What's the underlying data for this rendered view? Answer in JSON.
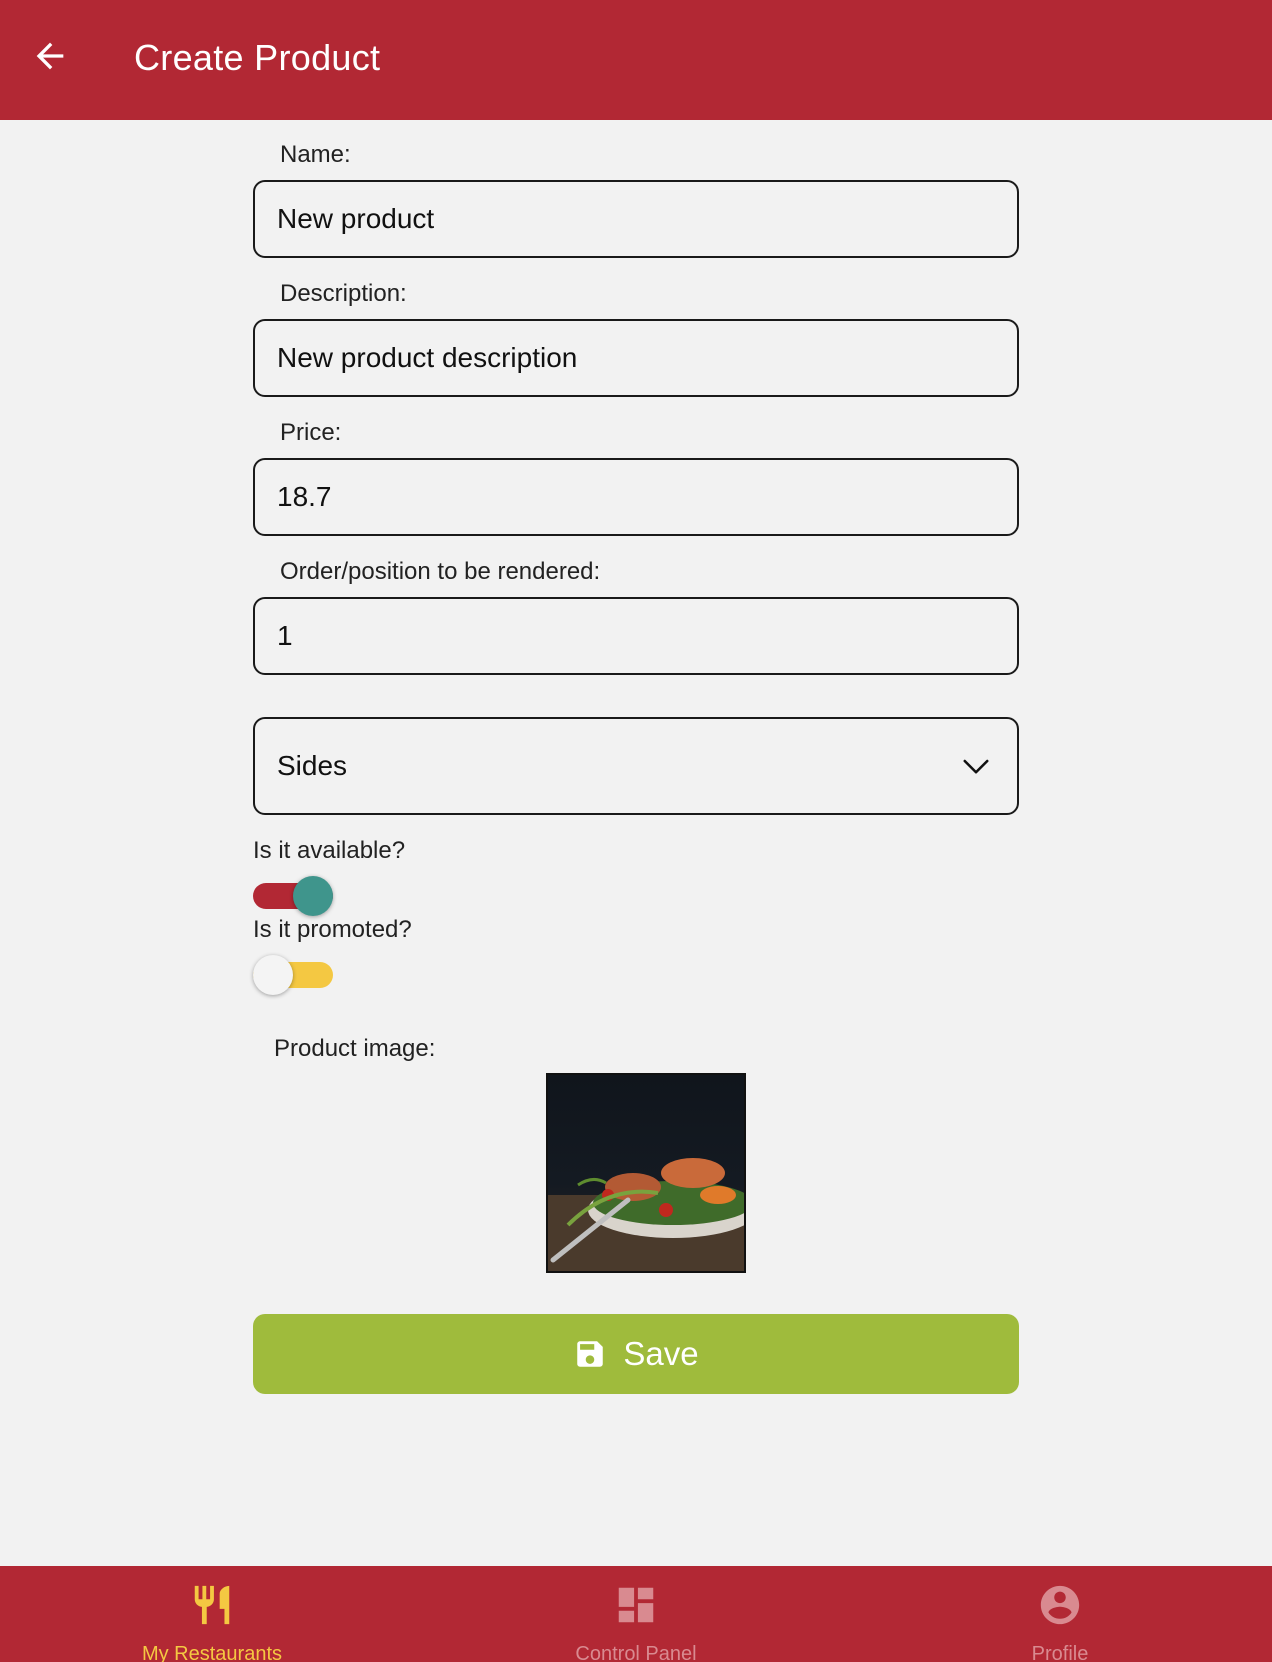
{
  "header": {
    "title": "Create Product",
    "back_icon": "arrow-left-icon"
  },
  "form": {
    "name": {
      "label": "Name:",
      "value": "New product"
    },
    "description": {
      "label": "Description:",
      "value": "New product description"
    },
    "price": {
      "label": "Price:",
      "value": "18.7"
    },
    "order": {
      "label": "Order/position to be rendered:",
      "value": "1"
    },
    "category": {
      "selected": "Sides",
      "icon": "chevron-down-icon"
    },
    "available": {
      "label": "Is it available?",
      "on": true
    },
    "promoted": {
      "label": "Is it promoted?",
      "on": false
    },
    "image": {
      "label": "Product image:"
    },
    "save": {
      "label": "Save",
      "icon": "save-icon"
    }
  },
  "tabs": [
    {
      "label": "My Restaurants",
      "icon": "fork-knife-icon",
      "active": true
    },
    {
      "label": "Control Panel",
      "icon": "dashboard-icon",
      "active": false
    },
    {
      "label": "Profile",
      "icon": "account-circle-icon",
      "active": false
    }
  ],
  "colors": {
    "brand_red": "#b22834",
    "save_green": "#9fbb3c",
    "switch_on_track": "#b22834",
    "switch_on_knob": "#3f958c",
    "switch_off_track": "#f4c842",
    "switch_off_knob": "#f4f4f4",
    "tab_active": "#f4c842",
    "tab_inactive": "#d98a90"
  }
}
